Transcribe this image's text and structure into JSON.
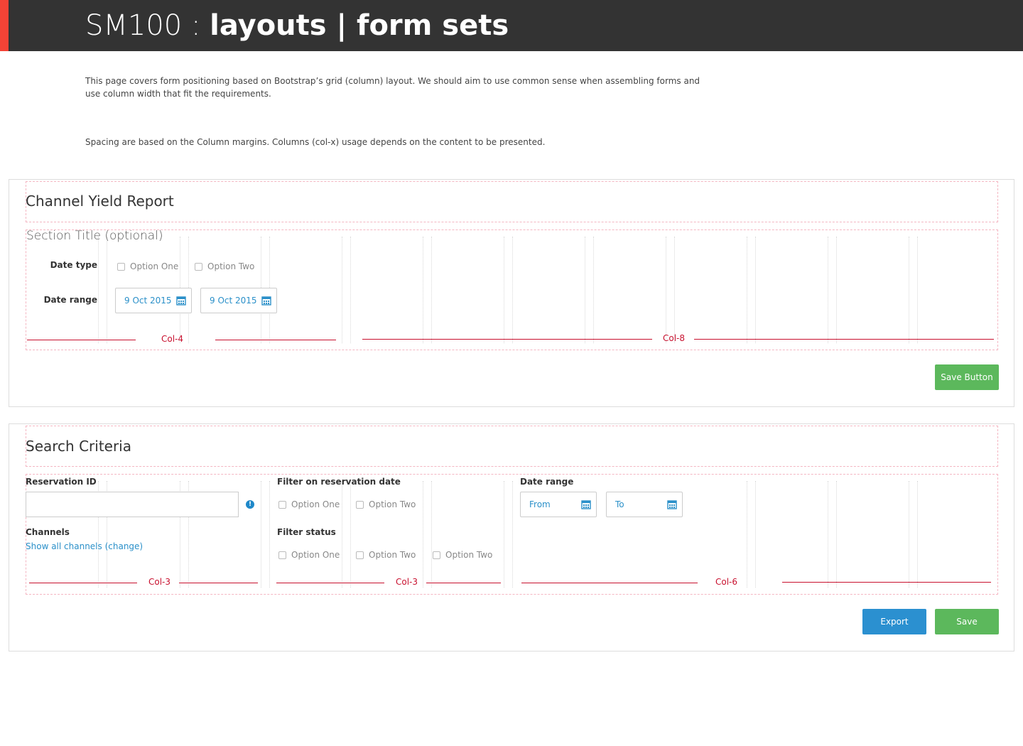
{
  "header": {
    "title_light": "SM100 : ",
    "title_bold": "layouts | form sets"
  },
  "intro": {
    "paragraph1": "This page covers form positioning based on Bootstrap’s grid (column) layout. We should aim to use common sense when assembling forms and use column width that fit the requirements.",
    "paragraph2": "Spacing are based on the Column margins. Columns (col-x) usage depends on the content to be presented."
  },
  "card1": {
    "title": "Channel Yield Report",
    "section_title": "Section Title (optional)",
    "date_type_label": "Date type",
    "date_type_options": [
      "Option One",
      "Option Two"
    ],
    "date_range_label": "Date range",
    "date_from_value": "9 Oct 2015",
    "date_to_value": "9 Oct 2015",
    "col_left_label": "Col-4",
    "col_right_label": "Col-8",
    "save_button": "Save Button"
  },
  "card2": {
    "title": "Search Criteria",
    "reservation_id_label": "Reservation ID",
    "reservation_id_value": "",
    "info_icon_glyph": "!",
    "channels_label": "Channels",
    "channels_link": "Show all channels (change)",
    "filter_date_label": "Filter on reservation date",
    "filter_date_options": [
      "Option One",
      "Option Two"
    ],
    "filter_status_label": "Filter status",
    "filter_status_options": [
      "Option One",
      "Option Two",
      "Option Two"
    ],
    "date_range_label": "Date range",
    "date_from_placeholder": "From",
    "date_to_placeholder": "To",
    "col_labels": [
      "Col-3",
      "Col-3",
      "Col-6"
    ],
    "export_button": "Export",
    "save_button": "Save"
  },
  "colors": {
    "header_bg": "#333333",
    "accent_red": "#f44336",
    "link_blue": "#2b90c9",
    "button_green": "#5cb85c",
    "button_blue": "#2b90d0",
    "guide_red": "#c8102e"
  },
  "icons": {
    "calendar": "calendar-icon",
    "info": "info-icon"
  }
}
